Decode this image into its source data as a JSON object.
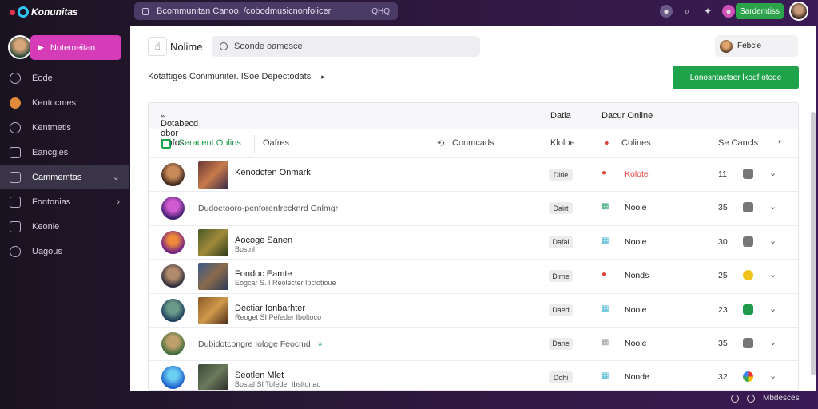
{
  "app": {
    "logo_text": "Konunitas",
    "dot_colors": [
      "#e8334a",
      "#f0a820"
    ]
  },
  "url_bar": {
    "text": "Bcommunitan Canoo. /cobodmusicnonfolicer",
    "right": "QHQ"
  },
  "topbar": {
    "green_button": "Sardemtiss"
  },
  "sidebar": {
    "profile_button": "Notemeitan",
    "items": [
      {
        "label": "Eode",
        "icon": "home-icon"
      },
      {
        "label": "Kentocmes",
        "icon": "games-icon"
      },
      {
        "label": "Kentmetis",
        "icon": "chat-icon"
      },
      {
        "label": "Eancgles",
        "icon": "list-icon"
      },
      {
        "label": "Cammemtas",
        "icon": "community-icon",
        "active": true,
        "chevron": true
      },
      {
        "label": "Fontonias",
        "icon": "forum-icon",
        "chevron": true
      },
      {
        "label": "Keonle",
        "icon": "news-icon"
      },
      {
        "label": "Uagous",
        "icon": "settings-icon"
      }
    ]
  },
  "main": {
    "title": "Nolime",
    "search_placeholder": "Soonde oamesce",
    "user_chip": "Febcle",
    "breadcrumb": "Kotaftiges Conimuniter. ISoe Depectodats",
    "primary_button": "Lonosntactser lkoqf otode"
  },
  "table": {
    "headers": {
      "name": "Dotabecd obor laufos",
      "date": "Datia",
      "status": "Dacur Online"
    },
    "filter": {
      "checkbox_label": "Ceracent Onlins",
      "col2": "Oafres",
      "col3": "Conmcads",
      "col4": "Kloloe",
      "col5": "Colines",
      "col6": "Se Cancls"
    },
    "rows": [
      {
        "name": "Kenodcfen Onmark",
        "sub": "",
        "badge": "Dirie",
        "status": "Kolote",
        "status_color": "#e0443a",
        "status_icon": "alert-icon",
        "num": "11",
        "action": "gray"
      },
      {
        "wide": "Dudoetooro-penforenfrecknrd Onlmgr",
        "badge": "Dairt",
        "status": "Noole",
        "status_color": "#333",
        "status_icon": "grid-icon",
        "num": "35",
        "action": "gray"
      },
      {
        "name": "Aocoge Sanen",
        "sub": "Bostnl",
        "badge": "Dafai",
        "status": "Noole",
        "status_color": "#333",
        "status_icon": "grid-icon",
        "num": "30",
        "action": "gray"
      },
      {
        "name": "Fondoc Eamte",
        "sub": "Eogcar S. I Reolecter Ipclotioue",
        "badge": "Dirne",
        "status": "Nonds",
        "status_color": "#333",
        "status_icon": "alert-icon",
        "num": "25",
        "action": "yellow"
      },
      {
        "name": "Dectiar Ionbarhter",
        "sub": "Reoget SI Pefeder Iboltoco",
        "badge": "Daed",
        "status": "Noole",
        "status_color": "#333",
        "status_icon": "grid-icon",
        "num": "23",
        "action": "green"
      },
      {
        "wide": "Dubidotcongre Iologe Feocmd",
        "badge": "Dane",
        "status": "Noole",
        "status_color": "#333",
        "status_icon": "grid-icon",
        "num": "35",
        "action": "gray"
      },
      {
        "name": "Seotlen Mlet",
        "sub": "Bostal SI Tofeder Ibsltonao",
        "badge": "Dohi",
        "status": "Nonde",
        "status_color": "#333",
        "status_icon": "grid-icon",
        "num": "32",
        "action": "multi"
      }
    ]
  },
  "footer": {
    "text": "Mbdesces"
  }
}
